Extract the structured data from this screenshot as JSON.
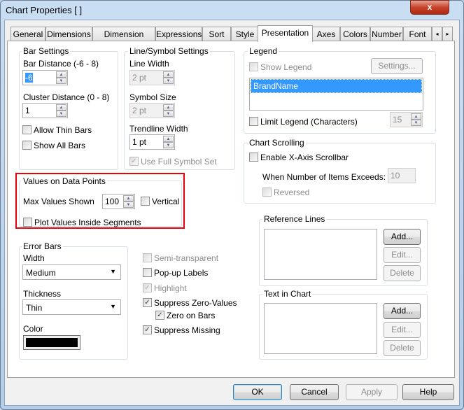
{
  "window": {
    "title": "Chart Properties [ ]",
    "close": "x"
  },
  "tabs": [
    "General",
    "Dimensions",
    "Dimension Limits",
    "Expressions",
    "Sort",
    "Style",
    "Presentation",
    "Axes",
    "Colors",
    "Number",
    "Font"
  ],
  "active_tab": "Presentation",
  "bar_settings": {
    "title": "Bar Settings",
    "bar_distance_label": "Bar Distance (-6 - 8)",
    "bar_distance": "-6",
    "cluster_distance_label": "Cluster Distance (0 - 8)",
    "cluster_distance": "1",
    "allow_thin_bars": "Allow Thin Bars",
    "show_all_bars": "Show All Bars"
  },
  "line_symbol": {
    "title": "Line/Symbol Settings",
    "line_width_label": "Line Width",
    "line_width": "2 pt",
    "symbol_size_label": "Symbol Size",
    "symbol_size": "2 pt",
    "trendline_width_label": "Trendline Width",
    "trendline_width": "1 pt",
    "use_full_symbol_set": "Use Full Symbol Set"
  },
  "values_on_data_points": {
    "title": "Values on Data Points",
    "max_values_label": "Max Values Shown",
    "max_values": "100",
    "vertical": "Vertical",
    "plot_inside": "Plot Values Inside Segments",
    "highlight_color": "#e8000b"
  },
  "error_bars": {
    "title": "Error Bars",
    "width_label": "Width",
    "width": "Medium",
    "thickness_label": "Thickness",
    "thickness": "Thin",
    "color_label": "Color",
    "color": "#000000"
  },
  "options": {
    "semi_transparent": "Semi-transparent",
    "popup_labels": "Pop-up Labels",
    "highlight": "Highlight",
    "suppress_zero": "Suppress Zero-Values",
    "zero_on_bars": "Zero on Bars",
    "suppress_missing": "Suppress Missing"
  },
  "legend": {
    "title": "Legend",
    "show_legend": "Show Legend",
    "settings": "Settings...",
    "items": [
      "BrandName"
    ],
    "limit_legend": "Limit Legend (Characters)",
    "limit_value": "15"
  },
  "chart_scrolling": {
    "title": "Chart Scrolling",
    "enable": "Enable X-Axis Scrollbar",
    "when_label": "When Number of Items Exceeds:",
    "when_value": "10",
    "reversed": "Reversed"
  },
  "reference_lines": {
    "title": "Reference Lines",
    "add": "Add...",
    "edit": "Edit...",
    "delete": "Delete"
  },
  "text_in_chart": {
    "title": "Text in Chart",
    "add": "Add...",
    "edit": "Edit...",
    "delete": "Delete"
  },
  "buttons": {
    "ok": "OK",
    "cancel": "Cancel",
    "apply": "Apply",
    "help": "Help"
  }
}
